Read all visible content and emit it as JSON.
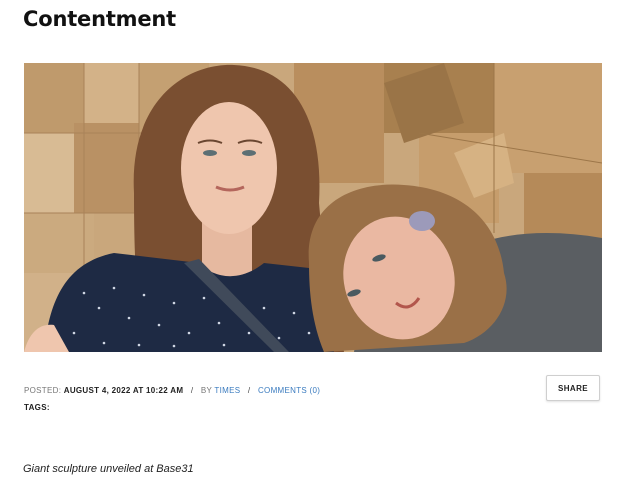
{
  "post": {
    "title": "Contentment",
    "image_alt": "Two women posing in front of a giant cardboard sculpture",
    "meta": {
      "posted_label": "POSTED:",
      "posted_value": "AUGUST 4, 2022 AT 10:22 AM",
      "separator": "/",
      "by_label": "BY",
      "author": "TIMES",
      "comments": "COMMENTS (0)"
    },
    "tags_label": "TAGS:",
    "share_label": "SHARE",
    "caption": "Giant sculpture unveiled at Base31"
  }
}
